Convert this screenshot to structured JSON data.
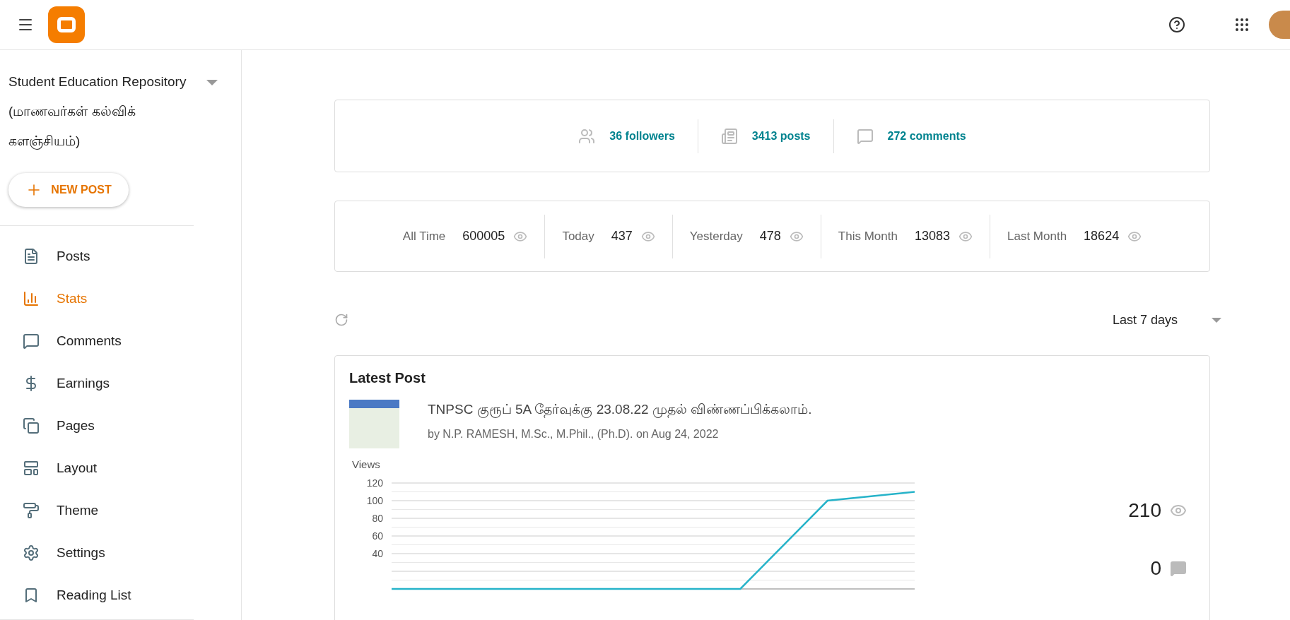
{
  "sidebar": {
    "blog_title": "Student Education Repository (மாணவர்கள் கல்விக் களஞ்சியம்)",
    "new_post": "NEW POST",
    "items": [
      {
        "label": "Posts",
        "selected": false
      },
      {
        "label": "Stats",
        "selected": true
      },
      {
        "label": "Comments",
        "selected": false
      },
      {
        "label": "Earnings",
        "selected": false
      },
      {
        "label": "Pages",
        "selected": false
      },
      {
        "label": "Layout",
        "selected": false
      },
      {
        "label": "Theme",
        "selected": false
      },
      {
        "label": "Settings",
        "selected": false
      },
      {
        "label": "Reading List",
        "selected": false
      }
    ]
  },
  "summary": [
    {
      "label": "36 followers"
    },
    {
      "label": "3413 posts"
    },
    {
      "label": "272 comments"
    }
  ],
  "views": [
    {
      "label": "All Time",
      "value": "600005"
    },
    {
      "label": "Today",
      "value": "437"
    },
    {
      "label": "Yesterday",
      "value": "478"
    },
    {
      "label": "This Month",
      "value": "13083"
    },
    {
      "label": "Last Month",
      "value": "18624"
    }
  ],
  "range": "Last 7 days",
  "latest_post": {
    "heading": "Latest Post",
    "title": "TNPSC குரூப் 5A தேர்வுக்கு 23.08.22 முதல் விண்ணப்பிக்கலாம்.",
    "byline": "by N.P. RAMESH, M.Sc., M.Phil., (Ph.D). on Aug 24, 2022",
    "views_total": "210",
    "comments_total": "0",
    "chart_data": {
      "type": "line",
      "ylabel": "Views",
      "series": [
        {
          "color": "#26b3c9",
          "values": [
            0,
            0,
            0,
            0,
            0,
            100,
            110
          ]
        }
      ],
      "ylim": [
        0,
        120
      ],
      "yticks": [
        40,
        60,
        80,
        100,
        120
      ],
      "grid": true
    }
  }
}
